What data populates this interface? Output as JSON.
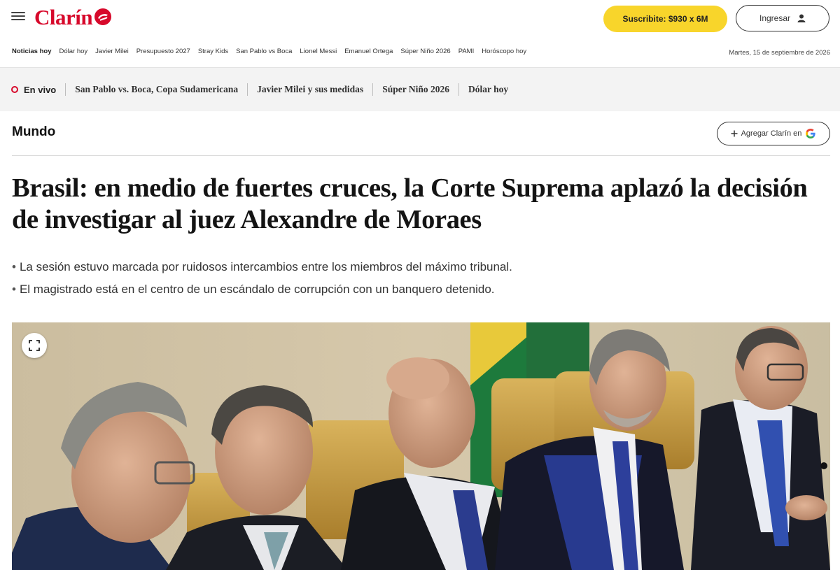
{
  "header": {
    "logo_text": "Clarín",
    "subscribe_label": "Suscribite: $930 x 6M",
    "login_label": "Ingresar"
  },
  "trending": {
    "items": [
      "Noticias hoy",
      "Dólar hoy",
      "Javier Milei",
      "Presupuesto 2027",
      "Stray Kids",
      "San Pablo vs Boca",
      "Lionel Messi",
      "Emanuel Ortega",
      "Súper Niño 2026",
      "PAMI",
      "Horóscopo hoy"
    ],
    "date": "Martes, 15 de septiembre de 2026"
  },
  "livebar": {
    "live_label": "En vivo",
    "links": [
      "San Pablo vs. Boca, Copa Sudamericana",
      "Javier Milei y sus medidas",
      "Súper Niño 2026",
      "Dólar hoy"
    ]
  },
  "section": {
    "label": "Mundo",
    "google_button": "Agregar Clarín en"
  },
  "article": {
    "headline": "Brasil: en medio de fuertes cruces, la Corte Suprema aplazó la decisión de investigar al juez Alexandre de Moraes",
    "bullets": [
      "La sesión estuvo marcada por ruidosos intercambios entre los miembros del máximo tribunal.",
      "El magistrado está en el centro de un escándalo de corrupción con un banquero detenido."
    ]
  },
  "colors": {
    "brand_red": "#d7092b",
    "subscribe_yellow": "#f8d52b",
    "live_bar_bg": "#f3f3f3"
  },
  "icons": [
    "hamburger-menu-icon",
    "clarin-logo-mark",
    "user-icon",
    "live-dot-icon",
    "plus-icon",
    "google-icon",
    "expand-icon"
  ]
}
